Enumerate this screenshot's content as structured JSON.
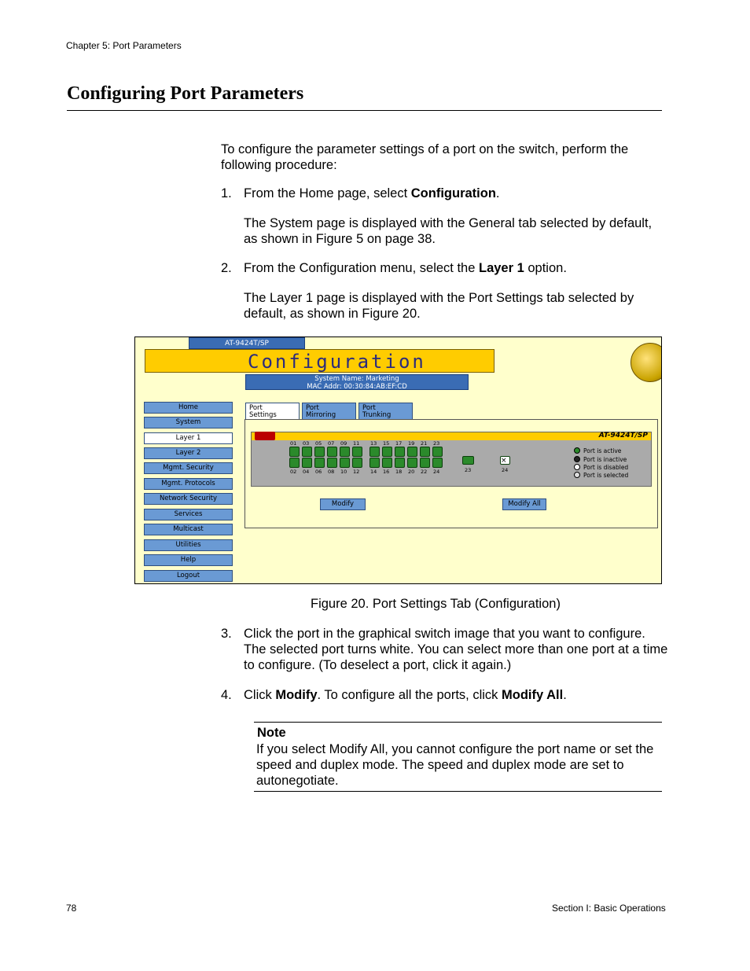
{
  "header": {
    "chapter": "Chapter 5: Port Parameters"
  },
  "title": "Configuring Port Parameters",
  "intro": "To configure the parameter settings of a port on the switch, perform the following procedure:",
  "steps": [
    {
      "num": "1.",
      "pre": "From the Home page, select ",
      "bold": "Configuration",
      "post": "."
    },
    {
      "num": "2.",
      "pre": "From the Configuration menu, select the ",
      "bold": "Layer 1",
      "post": " option."
    },
    {
      "num": "3.",
      "text": "Click the port in the graphical switch image that you want to configure. The selected port turns white. You can select more than one port at a time to configure. (To deselect a port, click it again.)"
    },
    {
      "num": "4.",
      "pre": "Click ",
      "bold": "Modify",
      "mid": ". To configure all the ports, click ",
      "bold2": "Modify All",
      "post": "."
    }
  ],
  "sub1": "The System page is displayed with the General tab selected by default, as shown in Figure 5 on page 38.",
  "sub2": "The Layer 1 page is displayed with the Port Settings tab selected by default, as shown in Figure 20.",
  "figure": {
    "model_tab": "AT-9424T/SP",
    "conf_title": "Configuration",
    "system_name": "System Name: Marketing",
    "mac_addr": "MAC Addr: 00:30:84:AB:EF:CD",
    "nav": [
      "Home",
      "System",
      "Layer 1",
      "Layer 2",
      "Mgmt. Security",
      "Mgmt. Protocols",
      "Network Security",
      "Services",
      "Multicast",
      "Utilities",
      "Help",
      "Logout"
    ],
    "tabs": [
      {
        "line1": "Port",
        "line2": "Settings"
      },
      {
        "line1": "Port",
        "line2": "Mirroring"
      },
      {
        "line1": "Port",
        "line2": "Trunking"
      }
    ],
    "switch_model": "AT-9424T/SP",
    "top_port_labels": [
      "01",
      "03",
      "05",
      "07",
      "09",
      "11",
      "13",
      "15",
      "17",
      "19",
      "21",
      "23"
    ],
    "bottom_port_labels": [
      "02",
      "04",
      "06",
      "08",
      "10",
      "12",
      "14",
      "16",
      "18",
      "20",
      "22",
      "24"
    ],
    "sfp_labels": [
      "23",
      "24"
    ],
    "legend": [
      "Port is active",
      "Port is inactive",
      "Port is disabled",
      "Port is selected"
    ],
    "modify_label": "Modify",
    "modify_all_label": "Modify All"
  },
  "caption": "Figure 20. Port Settings Tab (Configuration)",
  "note": {
    "title": "Note",
    "text": "If you select Modify All, you cannot configure the port name or set the speed and duplex mode. The speed and duplex mode are set to autonegotiate."
  },
  "footer": {
    "page": "78",
    "section": "Section I: Basic Operations"
  }
}
